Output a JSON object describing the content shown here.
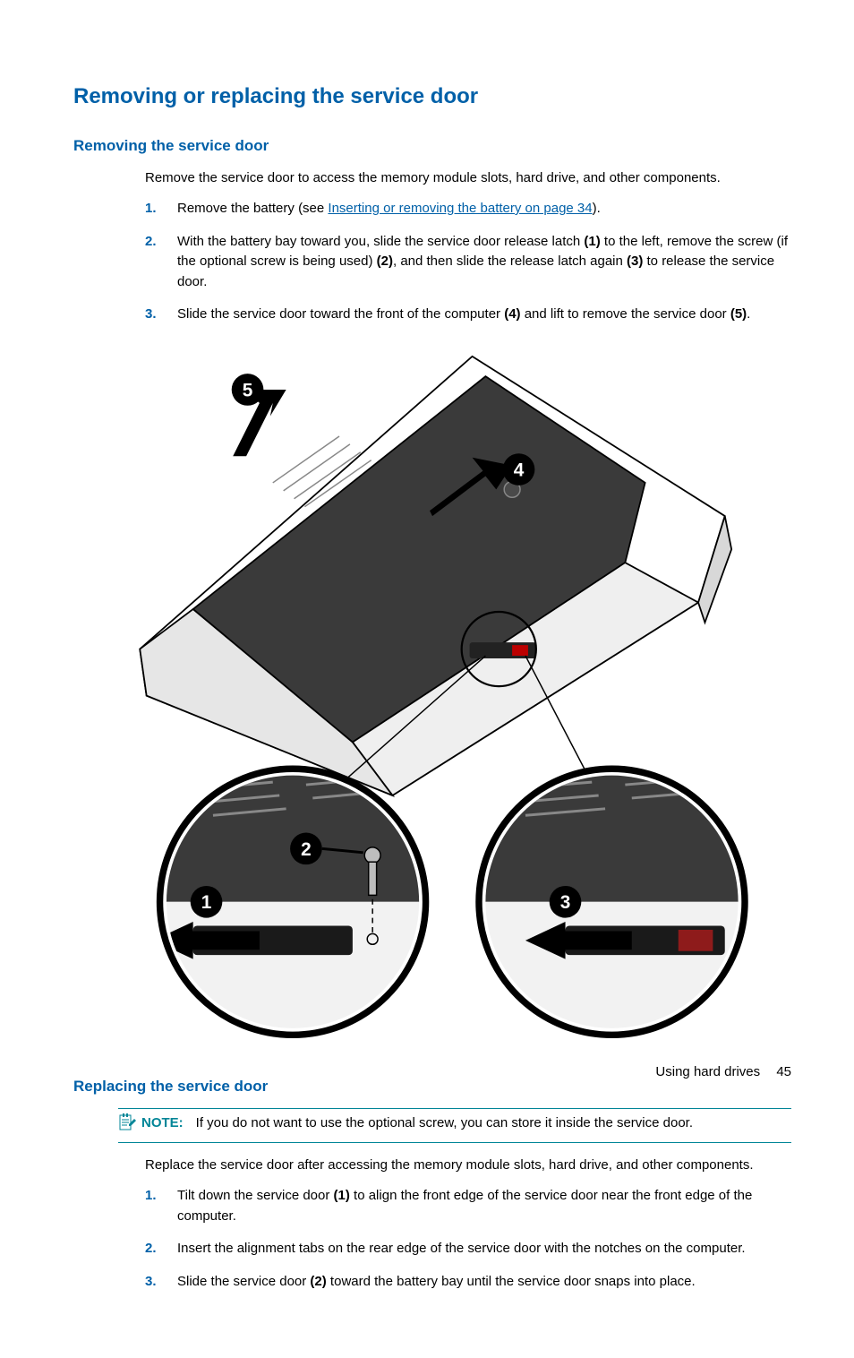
{
  "heading": "Removing or replacing the service door",
  "section1": {
    "title": "Removing the service door",
    "intro": "Remove the service door to access the memory module slots, hard drive, and other components.",
    "steps": [
      {
        "num": "1.",
        "pre": "Remove the battery (see ",
        "link": "Inserting or removing the battery on page 34",
        "post": ")."
      },
      {
        "num": "2.",
        "pre": "With the battery bay toward you, slide the service door release latch ",
        "b1": "(1)",
        "mid1": " to the left, remove the screw (if the optional screw is being used) ",
        "b2": "(2)",
        "mid2": ", and then slide the release latch again ",
        "b3": "(3)",
        "post": " to release the service door."
      },
      {
        "num": "3.",
        "pre": "Slide the service door toward the front of the computer ",
        "b1": "(4)",
        "mid1": " and lift to remove the service door ",
        "b2": "(5)",
        "post": "."
      }
    ]
  },
  "section2": {
    "title": "Replacing the service door",
    "note_label": "NOTE:",
    "note_text": "If you do not want to use the optional screw, you can store it inside the service door.",
    "intro": "Replace the service door after accessing the memory module slots, hard drive, and other components.",
    "steps": [
      {
        "num": "1.",
        "pre": "Tilt down the service door ",
        "b1": "(1)",
        "post": " to align the front edge of the service door near the front edge of the computer."
      },
      {
        "num": "2.",
        "text": "Insert the alignment tabs on the rear edge of the service door with the notches on the computer."
      },
      {
        "num": "3.",
        "pre": "Slide the service door ",
        "b1": "(2)",
        "post": " toward the battery bay until the service door snaps into place."
      }
    ]
  },
  "footer": {
    "section": "Using hard drives",
    "page": "45"
  },
  "callouts": {
    "c1": "1",
    "c2": "2",
    "c3": "3",
    "c4": "4",
    "c5": "5"
  }
}
